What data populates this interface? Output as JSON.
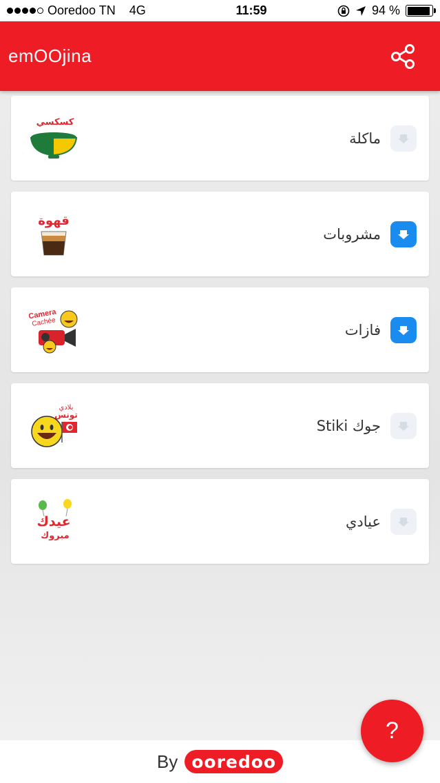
{
  "status_bar": {
    "carrier": "Ooredoo TN",
    "network": "4G",
    "time": "11:59",
    "battery": "94 %",
    "battery_level": 0.94,
    "signal_bars": 4
  },
  "app_bar": {
    "title": "emOOjina",
    "share_icon": "share-icon",
    "bg_color": "#ee1c25"
  },
  "packs": [
    {
      "label": "ماكلة",
      "sticker_text": "كسكسي",
      "downloaded": false,
      "icon": "couscous-sticker"
    },
    {
      "label": "مشروبات",
      "sticker_text": "قهوة",
      "downloaded": true,
      "icon": "coffee-sticker"
    },
    {
      "label": "فازات",
      "sticker_text_1": "Camera",
      "sticker_text_2": "Cachée",
      "downloaded": true,
      "icon": "camera-sticker"
    },
    {
      "label": "جوك Stiki",
      "sticker_text_1": "بلادي",
      "sticker_text_2": "تونس",
      "downloaded": false,
      "icon": "smiley-flag-sticker"
    },
    {
      "label": "عيادي",
      "sticker_text_1": "عيدك",
      "sticker_text_2": "مبروك",
      "downloaded": false,
      "icon": "eid-sticker"
    }
  ],
  "fab": {
    "label": "?"
  },
  "footer": {
    "by": "By",
    "brand": "ooredoo"
  },
  "colors": {
    "accent": "#ee1c25",
    "download_active": "#1a8cf0"
  }
}
